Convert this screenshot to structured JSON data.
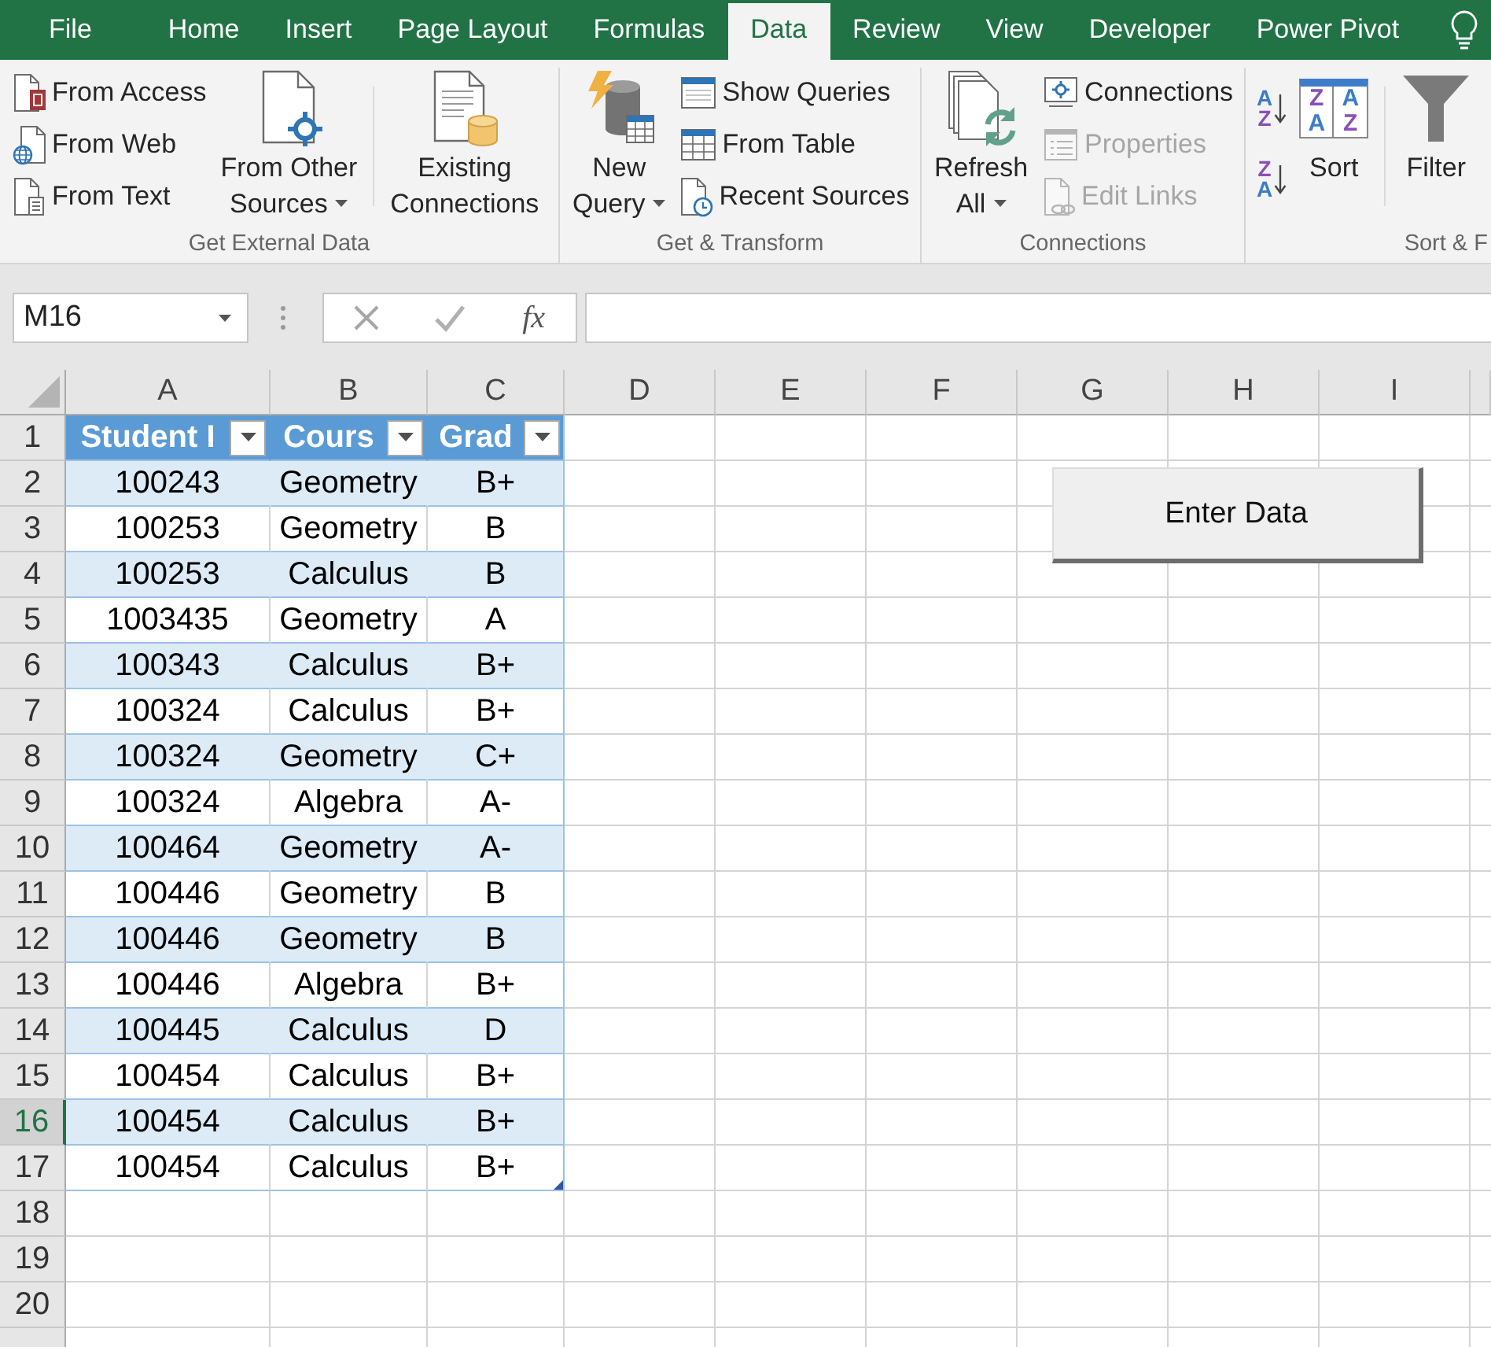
{
  "ribbon_tabs": [
    {
      "label": "File",
      "selected": false
    },
    {
      "label": "Home",
      "selected": false
    },
    {
      "label": "Insert",
      "selected": false
    },
    {
      "label": "Page Layout",
      "selected": false
    },
    {
      "label": "Formulas",
      "selected": false
    },
    {
      "label": "Data",
      "selected": true
    },
    {
      "label": "Review",
      "selected": false
    },
    {
      "label": "View",
      "selected": false
    },
    {
      "label": "Developer",
      "selected": false
    },
    {
      "label": "Power Pivot",
      "selected": false
    }
  ],
  "ribbon_groups": [
    {
      "label": "Get External Data",
      "items": [
        {
          "kind": "small_stack",
          "buttons": [
            {
              "label": "From Access",
              "disabled": false
            },
            {
              "label": "From Web",
              "disabled": false
            },
            {
              "label": "From Text",
              "disabled": false
            }
          ]
        },
        {
          "kind": "large",
          "lines": [
            "From Other",
            "Sources"
          ],
          "dropdown": true,
          "disabled": false
        },
        {
          "kind": "separator"
        },
        {
          "kind": "large",
          "lines": [
            "Existing",
            "Connections"
          ],
          "dropdown": false,
          "disabled": false
        }
      ]
    },
    {
      "label": "Get & Transform",
      "items": [
        {
          "kind": "large",
          "lines": [
            "New",
            "Query"
          ],
          "dropdown": true,
          "disabled": false
        },
        {
          "kind": "small_stack",
          "buttons": [
            {
              "label": "Show Queries",
              "disabled": false
            },
            {
              "label": "From Table",
              "disabled": false
            },
            {
              "label": "Recent Sources",
              "disabled": false
            }
          ]
        }
      ]
    },
    {
      "label": "Connections",
      "items": [
        {
          "kind": "large",
          "lines": [
            "Refresh",
            "All"
          ],
          "dropdown": true,
          "disabled": false
        },
        {
          "kind": "small_stack",
          "buttons": [
            {
              "label": "Connections",
              "disabled": false
            },
            {
              "label": "Properties",
              "disabled": true
            },
            {
              "label": "Edit Links",
              "disabled": true
            }
          ]
        }
      ]
    },
    {
      "label": "Sort & F",
      "items": [
        {
          "kind": "sort_pair",
          "buttons": [
            {
              "glyphs": [
                {
                  "text": "A",
                  "color": "#3b7dc8"
                },
                {
                  "text": "Z",
                  "color": "#8a4fb8"
                }
              ]
            },
            {
              "glyphs": [
                {
                  "text": "Z",
                  "color": "#8a4fb8"
                },
                {
                  "text": "A",
                  "color": "#3b7dc8"
                }
              ]
            }
          ]
        },
        {
          "kind": "large",
          "lines": [
            "Sort"
          ],
          "glyphs": [
            {
              "text": "Z",
              "color": "#8a4fb8"
            },
            {
              "text": "A",
              "color": "#3b7dc8"
            },
            {
              "text": "A",
              "color": "#3b7dc8"
            },
            {
              "text": "Z",
              "color": "#8a4fb8"
            }
          ],
          "dropdown": false,
          "disabled": false
        },
        {
          "kind": "separator"
        },
        {
          "kind": "large",
          "lines": [
            "Filter"
          ],
          "dropdown": false,
          "disabled": false
        }
      ]
    }
  ],
  "formula_bar": {
    "name_box": "M16",
    "function_button": "fx"
  },
  "sheet": {
    "columns": [
      "A",
      "B",
      "C",
      "D",
      "E",
      "F",
      "G",
      "H",
      "I"
    ],
    "rows": [
      {
        "label": "1",
        "selected": false
      },
      {
        "label": "2",
        "selected": false
      },
      {
        "label": "3",
        "selected": false
      },
      {
        "label": "4",
        "selected": false
      },
      {
        "label": "5",
        "selected": false
      },
      {
        "label": "6",
        "selected": false
      },
      {
        "label": "7",
        "selected": false
      },
      {
        "label": "8",
        "selected": false
      },
      {
        "label": "9",
        "selected": false
      },
      {
        "label": "10",
        "selected": false
      },
      {
        "label": "11",
        "selected": false
      },
      {
        "label": "12",
        "selected": false
      },
      {
        "label": "13",
        "selected": false
      },
      {
        "label": "14",
        "selected": false
      },
      {
        "label": "15",
        "selected": false
      },
      {
        "label": "16",
        "selected": true
      },
      {
        "label": "17",
        "selected": false
      },
      {
        "label": "18",
        "selected": false
      },
      {
        "label": "19",
        "selected": false
      },
      {
        "label": "20",
        "selected": false
      }
    ],
    "table": {
      "headers": [
        "Student I",
        "Cours",
        "Grad"
      ],
      "rows": [
        [
          "100243",
          "Geometry",
          "B+"
        ],
        [
          "100253",
          "Geometry",
          "B"
        ],
        [
          "100253",
          "Calculus",
          "B"
        ],
        [
          "1003435",
          "Geometry",
          "A"
        ],
        [
          "100343",
          "Calculus",
          "B+"
        ],
        [
          "100324",
          "Calculus",
          "B+"
        ],
        [
          "100324",
          "Geometry",
          "C+"
        ],
        [
          "100324",
          "Algebra",
          "A-"
        ],
        [
          "100464",
          "Geometry",
          "A-"
        ],
        [
          "100446",
          "Geometry",
          "B"
        ],
        [
          "100446",
          "Geometry",
          "B"
        ],
        [
          "100446",
          "Algebra",
          "B+"
        ],
        [
          "100445",
          "Calculus",
          "D"
        ],
        [
          "100454",
          "Calculus",
          "B+"
        ],
        [
          "100454",
          "Calculus",
          "B+"
        ],
        [
          "100454",
          "Calculus",
          "B+"
        ]
      ]
    },
    "button": {
      "label": "Enter Data"
    }
  }
}
